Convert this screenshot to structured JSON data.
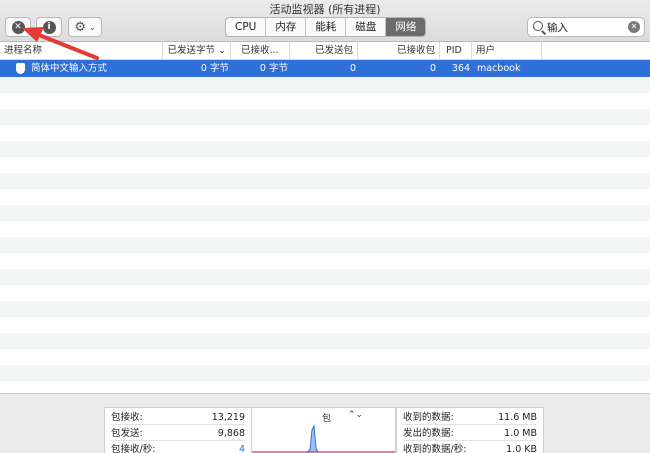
{
  "window": {
    "title": "活动监视器 (所有进程)"
  },
  "toolbar": {
    "stop_button_glyph": "✕",
    "info_button_glyph": "i",
    "gear_glyph": "⚙",
    "gear_chevron": "⌄",
    "tabs": [
      {
        "label": "CPU",
        "active": false
      },
      {
        "label": "内存",
        "active": false
      },
      {
        "label": "能耗",
        "active": false
      },
      {
        "label": "磁盘",
        "active": false
      },
      {
        "label": "网络",
        "active": true
      }
    ],
    "search": {
      "value": "输入",
      "clear_glyph": "✕"
    }
  },
  "table": {
    "columns": [
      {
        "label": "进程名称"
      },
      {
        "label": "已发送字节 ⌄"
      },
      {
        "label": "已接收..."
      },
      {
        "label": "已发送包"
      },
      {
        "label": "已接收包"
      },
      {
        "label": "PID"
      },
      {
        "label": "用户"
      }
    ],
    "rows": [
      {
        "name": "简体中文输入方式",
        "bytes_sent": "0 字节",
        "bytes_received": "0 字节",
        "packets_sent": "0",
        "packets_received": "0",
        "pid": "364",
        "user": "macbook",
        "selected": true
      }
    ]
  },
  "bottom": {
    "left_stats": [
      {
        "label": "包接收:",
        "value": "13,219"
      },
      {
        "label": "包发送:",
        "value": "9,868"
      },
      {
        "label": "包接收/秒:",
        "value": "4"
      }
    ],
    "graph": {
      "label": "包",
      "chevron": "⌃⌄"
    },
    "right_stats": [
      {
        "label": "收到的数据:",
        "value": "11.6 MB"
      },
      {
        "label": "发出的数据:",
        "value": "1.0 MB"
      },
      {
        "label": "收到的数据/秒:",
        "value": "1.0 KB"
      }
    ]
  },
  "colors": {
    "selection": "#2f6fd8",
    "stripe": "#f4f5f5",
    "annotation_arrow": "#e53935",
    "graph_received": "#2f6fd8",
    "graph_sent": "#d0337a"
  }
}
